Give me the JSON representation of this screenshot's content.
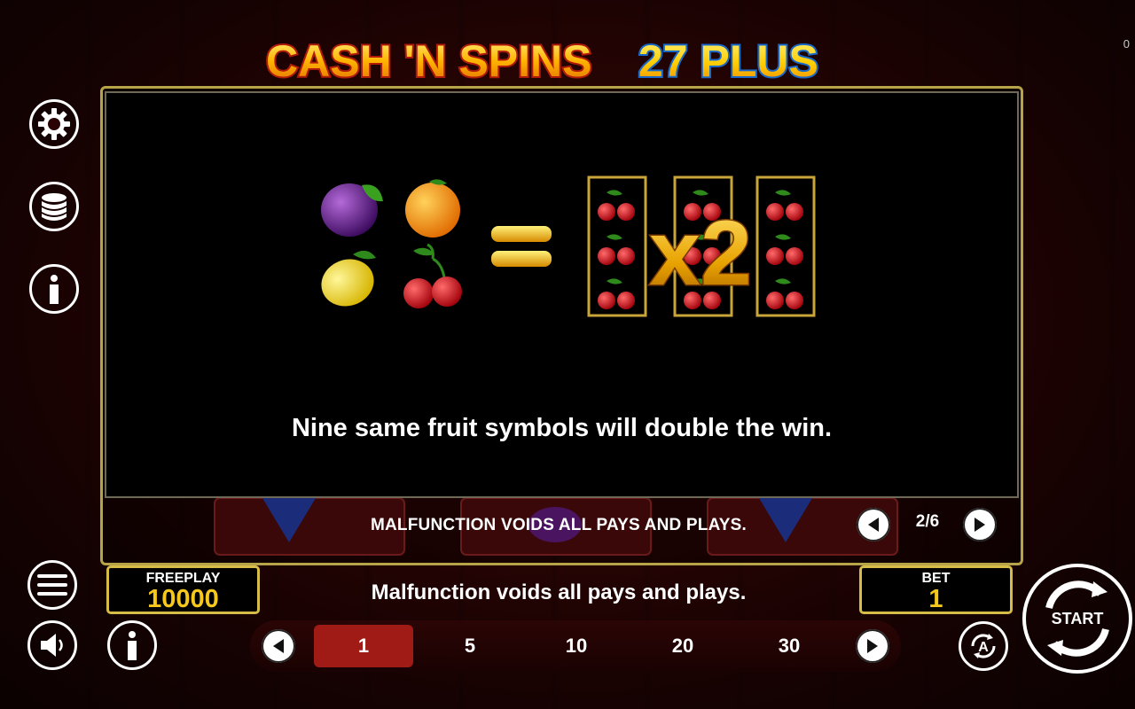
{
  "game": {
    "title_part1": "CASH 'N SPINS",
    "title_part2": "27 PLUS",
    "corner_counter": "0"
  },
  "side_menu": {
    "icons": [
      "gear-icon",
      "coins-stack-icon",
      "info-icon",
      "hamburger-menu-icon",
      "speaker-icon",
      "info-icon"
    ]
  },
  "paytable": {
    "rule_text": "Nine same fruit symbols will double the win.",
    "multiplier_label": "x2",
    "fruits": [
      "plum",
      "orange",
      "lemon",
      "cherry"
    ],
    "page": "2/6"
  },
  "notice_top": "MALFUNCTION VOIDS ALL PAYS AND PLAYS.",
  "notice_bottom": "Malfunction voids all pays and plays.",
  "freeplay": {
    "label": "FREEPLAY",
    "value": "10000"
  },
  "bet": {
    "label": "BET",
    "value": "1"
  },
  "bet_options": [
    "1",
    "5",
    "10",
    "20",
    "30"
  ],
  "selected_bet": "1",
  "start_label": "START",
  "colors": {
    "gold": "#d6bd47",
    "value_yellow": "#f7c81c",
    "selected_red": "#a01b15"
  }
}
